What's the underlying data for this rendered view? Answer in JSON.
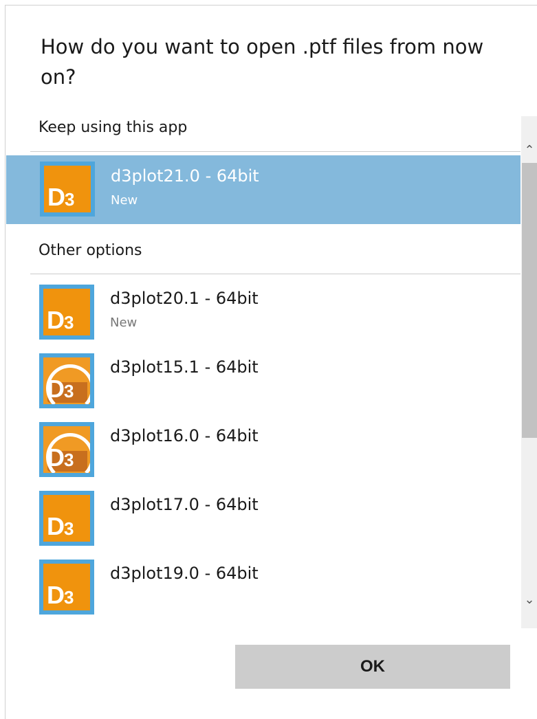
{
  "dialog": {
    "title": "How do you want to open .ptf files from now on?",
    "keep_header": "Keep using this app",
    "other_header": "Other options",
    "ok_label": "OK"
  },
  "selected_app": {
    "name": "d3plot21.0 - 64bit",
    "sub": "New",
    "icon": "d3-icon"
  },
  "apps": [
    {
      "name": "d3plot20.1 - 64bit",
      "sub": "New",
      "icon": "d3-icon"
    },
    {
      "name": "d3plot15.1 - 64bit",
      "sub": "",
      "icon": "d3-legacy-icon"
    },
    {
      "name": "d3plot16.0 - 64bit",
      "sub": "",
      "icon": "d3-legacy-icon"
    },
    {
      "name": "d3plot17.0 - 64bit",
      "sub": "",
      "icon": "d3-icon"
    },
    {
      "name": "d3plot19.0 - 64bit",
      "sub": "",
      "icon": "d3-icon"
    }
  ],
  "colors": {
    "selection": "#84b9dc",
    "icon_border": "#4ea6dc",
    "icon_fill": "#f0930d",
    "button": "#cccccc"
  }
}
